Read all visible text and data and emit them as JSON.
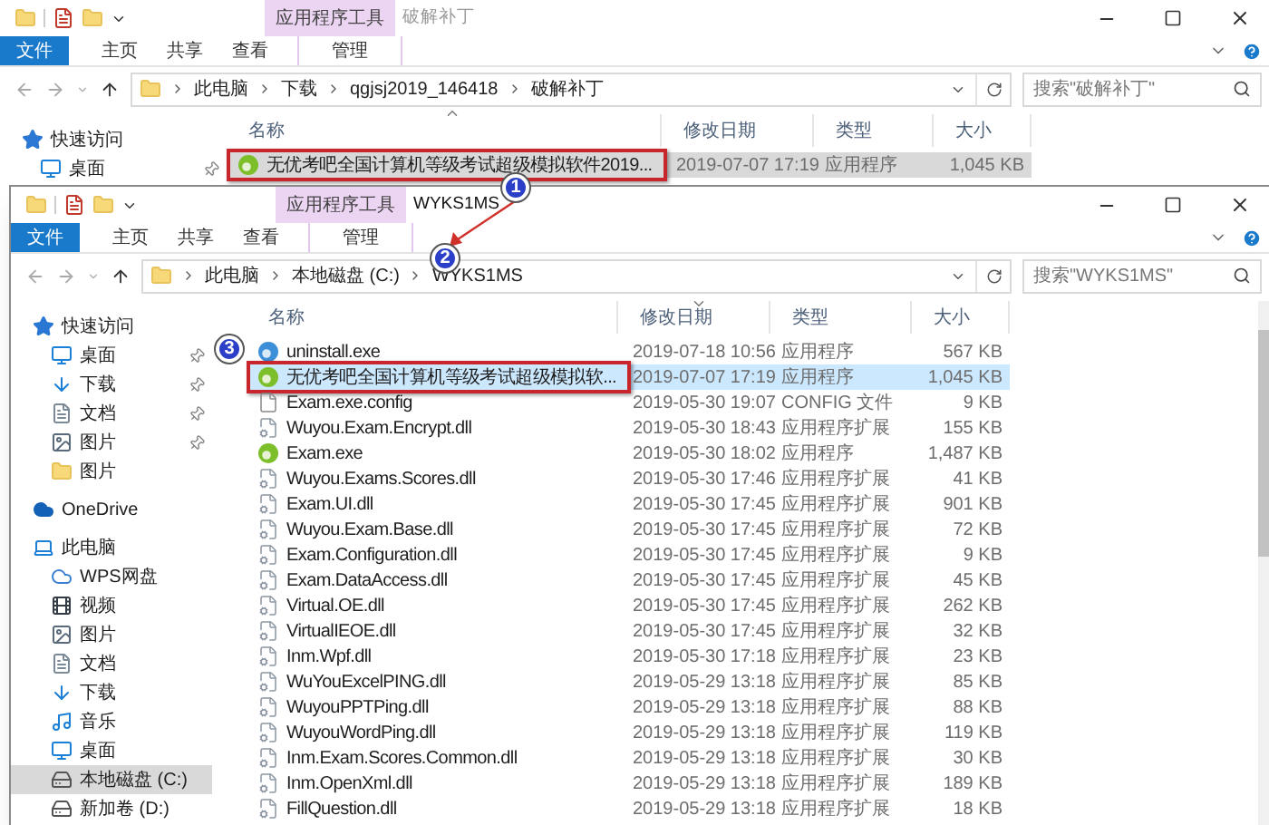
{
  "windows": [
    {
      "active": false,
      "title": "破解补丁",
      "tool_tab": "应用程序工具",
      "ribbon_tabs": [
        {
          "label": "文件",
          "kind": "file"
        },
        {
          "label": "主页",
          "kind": "plain"
        },
        {
          "label": "共享",
          "kind": "plain"
        },
        {
          "label": "查看",
          "kind": "plain"
        },
        {
          "label": "管理",
          "kind": "context"
        }
      ],
      "breadcrumbs": [
        "此电脑",
        "下载",
        "qgjsj2019_146418",
        "破解补丁"
      ],
      "search": {
        "placeholder": "搜索\"破解补丁\""
      },
      "sidebar": [
        {
          "label": "快速访问",
          "kind": "star",
          "pinned": false,
          "selected": false,
          "children": [
            {
              "label": "桌面",
              "kind": "desktop",
              "pinned": true,
              "selected": false
            }
          ]
        }
      ],
      "columns": [
        {
          "label": "名称",
          "sorted": true,
          "descending": false
        },
        {
          "label": "修改日期",
          "sorted": false
        },
        {
          "label": "类型",
          "sorted": false
        },
        {
          "label": "大小",
          "sorted": false
        }
      ],
      "rows": [
        {
          "kind": "app",
          "name": "无优考吧全国计算机等级考试超级模拟软件2019...",
          "modified": "2019-07-07 17:19",
          "type": "应用程序",
          "size": "1,045 KB",
          "selected": true,
          "highlighted": true
        }
      ]
    },
    {
      "active": true,
      "title": "WYKS1MS",
      "tool_tab": "应用程序工具",
      "ribbon_tabs": [
        {
          "label": "文件",
          "kind": "file"
        },
        {
          "label": "主页",
          "kind": "plain"
        },
        {
          "label": "共享",
          "kind": "plain"
        },
        {
          "label": "查看",
          "kind": "plain"
        },
        {
          "label": "管理",
          "kind": "context"
        }
      ],
      "breadcrumbs": [
        "此电脑",
        "本地磁盘 (C:)",
        "WYKS1MS"
      ],
      "search": {
        "placeholder": "搜索\"WYKS1MS\""
      },
      "sidebar": [
        {
          "label": "快速访问",
          "kind": "star",
          "pinned": false,
          "selected": false,
          "children": [
            {
              "label": "桌面",
              "kind": "desktop",
              "pinned": true,
              "selected": false
            },
            {
              "label": "下载",
              "kind": "download",
              "pinned": true,
              "selected": false
            },
            {
              "label": "文档",
              "kind": "document",
              "pinned": true,
              "selected": false
            },
            {
              "label": "图片",
              "kind": "picture",
              "pinned": true,
              "selected": false
            },
            {
              "label": "图片",
              "kind": "folder",
              "pinned": false,
              "selected": false
            }
          ]
        },
        {
          "label": "OneDrive",
          "kind": "cloud",
          "pinned": false,
          "selected": false
        },
        {
          "label": "此电脑",
          "kind": "pc",
          "pinned": false,
          "selected": false,
          "children": [
            {
              "label": "WPS网盘",
              "kind": "netdisk",
              "pinned": false,
              "selected": false
            },
            {
              "label": "视频",
              "kind": "video",
              "pinned": false,
              "selected": false
            },
            {
              "label": "图片",
              "kind": "picture",
              "pinned": false,
              "selected": false
            },
            {
              "label": "文档",
              "kind": "document",
              "pinned": false,
              "selected": false
            },
            {
              "label": "下载",
              "kind": "download",
              "pinned": false,
              "selected": false
            },
            {
              "label": "音乐",
              "kind": "music",
              "pinned": false,
              "selected": false
            },
            {
              "label": "桌面",
              "kind": "desktop",
              "pinned": false,
              "selected": false
            },
            {
              "label": "本地磁盘 (C:)",
              "kind": "drive",
              "pinned": false,
              "selected": true
            },
            {
              "label": "新加卷 (D:)",
              "kind": "drive",
              "pinned": false,
              "selected": false
            }
          ]
        }
      ],
      "columns": [
        {
          "label": "名称",
          "sorted": false
        },
        {
          "label": "修改日期",
          "sorted": true,
          "descending": true
        },
        {
          "label": "类型",
          "sorted": false
        },
        {
          "label": "大小",
          "sorted": false
        }
      ],
      "rows": [
        {
          "kind": "uninstall",
          "name": "uninstall.exe",
          "modified": "2019-07-18 10:56",
          "type": "应用程序",
          "size": "567 KB",
          "selected": false,
          "highlighted": false
        },
        {
          "kind": "app",
          "name": "无优考吧全国计算机等级考试超级模拟软...",
          "modified": "2019-07-07 17:19",
          "type": "应用程序",
          "size": "1,045 KB",
          "selected": true,
          "highlighted": true
        },
        {
          "kind": "config",
          "name": "Exam.exe.config",
          "modified": "2019-05-30 19:07",
          "type": "CONFIG 文件",
          "size": "9 KB",
          "selected": false,
          "highlighted": false
        },
        {
          "kind": "dll",
          "name": "Wuyou.Exam.Encrypt.dll",
          "modified": "2019-05-30 18:43",
          "type": "应用程序扩展",
          "size": "155 KB",
          "selected": false,
          "highlighted": false
        },
        {
          "kind": "app",
          "name": "Exam.exe",
          "modified": "2019-05-30 18:02",
          "type": "应用程序",
          "size": "1,487 KB",
          "selected": false,
          "highlighted": false
        },
        {
          "kind": "dll",
          "name": "Wuyou.Exams.Scores.dll",
          "modified": "2019-05-30 17:46",
          "type": "应用程序扩展",
          "size": "41 KB",
          "selected": false,
          "highlighted": false
        },
        {
          "kind": "dll",
          "name": "Exam.UI.dll",
          "modified": "2019-05-30 17:45",
          "type": "应用程序扩展",
          "size": "901 KB",
          "selected": false,
          "highlighted": false
        },
        {
          "kind": "dll",
          "name": "Wuyou.Exam.Base.dll",
          "modified": "2019-05-30 17:45",
          "type": "应用程序扩展",
          "size": "72 KB",
          "selected": false,
          "highlighted": false
        },
        {
          "kind": "dll",
          "name": "Exam.Configuration.dll",
          "modified": "2019-05-30 17:45",
          "type": "应用程序扩展",
          "size": "9 KB",
          "selected": false,
          "highlighted": false
        },
        {
          "kind": "dll",
          "name": "Exam.DataAccess.dll",
          "modified": "2019-05-30 17:45",
          "type": "应用程序扩展",
          "size": "45 KB",
          "selected": false,
          "highlighted": false
        },
        {
          "kind": "dll",
          "name": "Virtual.OE.dll",
          "modified": "2019-05-30 17:45",
          "type": "应用程序扩展",
          "size": "262 KB",
          "selected": false,
          "highlighted": false
        },
        {
          "kind": "dll",
          "name": "VirtualIEOE.dll",
          "modified": "2019-05-30 17:45",
          "type": "应用程序扩展",
          "size": "32 KB",
          "selected": false,
          "highlighted": false
        },
        {
          "kind": "dll",
          "name": "Inm.Wpf.dll",
          "modified": "2019-05-30 17:18",
          "type": "应用程序扩展",
          "size": "23 KB",
          "selected": false,
          "highlighted": false
        },
        {
          "kind": "dll",
          "name": "WuYouExcelPING.dll",
          "modified": "2019-05-29 13:18",
          "type": "应用程序扩展",
          "size": "85 KB",
          "selected": false,
          "highlighted": false
        },
        {
          "kind": "dll",
          "name": "WuyouPPTPing.dll",
          "modified": "2019-05-29 13:18",
          "type": "应用程序扩展",
          "size": "88 KB",
          "selected": false,
          "highlighted": false
        },
        {
          "kind": "dll",
          "name": "WuyouWordPing.dll",
          "modified": "2019-05-29 13:18",
          "type": "应用程序扩展",
          "size": "119 KB",
          "selected": false,
          "highlighted": false
        },
        {
          "kind": "dll",
          "name": "Inm.Exam.Scores.Common.dll",
          "modified": "2019-05-29 13:18",
          "type": "应用程序扩展",
          "size": "30 KB",
          "selected": false,
          "highlighted": false
        },
        {
          "kind": "dll",
          "name": "Inm.OpenXml.dll",
          "modified": "2019-05-29 13:18",
          "type": "应用程序扩展",
          "size": "189 KB",
          "selected": false,
          "highlighted": false
        },
        {
          "kind": "dll",
          "name": "FillQuestion.dll",
          "modified": "2019-05-29 13:18",
          "type": "应用程序扩展",
          "size": "18 KB",
          "selected": false,
          "highlighted": false
        }
      ]
    }
  ],
  "annotations": [
    {
      "label": "1"
    },
    {
      "label": "2"
    },
    {
      "label": "3"
    }
  ]
}
